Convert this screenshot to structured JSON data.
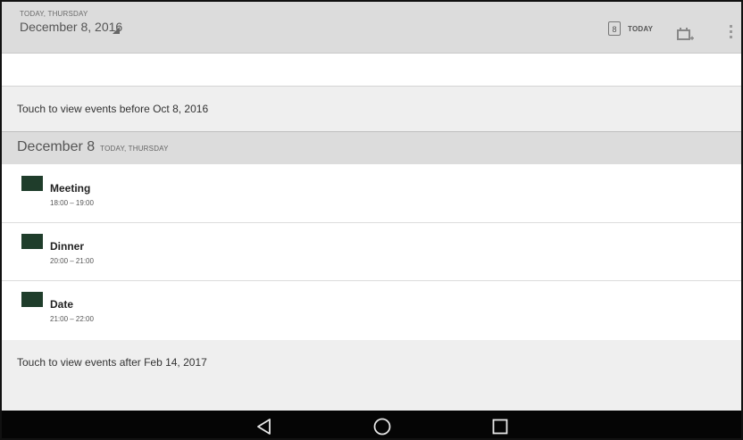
{
  "actionbar": {
    "small_label": "TODAY, THURSDAY",
    "date_label": "December 8, 2016",
    "today_icon_number": "8",
    "today_label": "TODAY"
  },
  "list": {
    "touch_before": "Touch to view events before Oct 8, 2016",
    "day_header": {
      "date": "December 8",
      "sub": "TODAY, THURSDAY"
    },
    "events": [
      {
        "title": "Meeting",
        "time": "18:00 – 19:00",
        "color": "#1f3d2b"
      },
      {
        "title": "Dinner",
        "time": "20:00 – 21:00",
        "color": "#1f3d2b"
      },
      {
        "title": "Date",
        "time": "21:00 – 22:00",
        "color": "#1f3d2b"
      }
    ],
    "touch_after": "Touch to view events after Feb 14, 2017"
  },
  "navbar": {
    "icons": [
      "back-icon",
      "home-icon",
      "recents-icon"
    ]
  }
}
